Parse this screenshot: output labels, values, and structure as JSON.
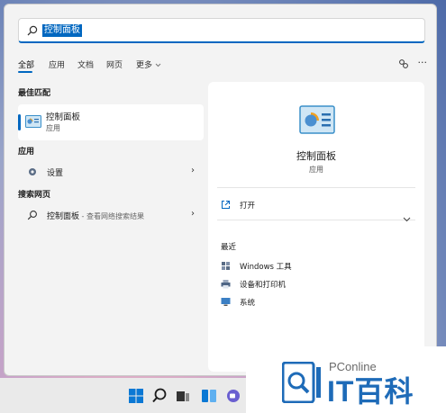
{
  "search": {
    "value": "控制面板"
  },
  "tabs": [
    {
      "label": "全部",
      "active": true
    },
    {
      "label": "应用"
    },
    {
      "label": "文档"
    },
    {
      "label": "网页"
    },
    {
      "label": "更多"
    }
  ],
  "toolbar": {
    "more_label": "···"
  },
  "sections": {
    "best_match": "最佳匹配",
    "apps": "应用",
    "web": "搜索网页"
  },
  "best_match": {
    "name": "控制面板",
    "type": "应用"
  },
  "apps": [
    {
      "label": "设置"
    }
  ],
  "web": [
    {
      "label": "控制面板",
      "suffix": " - 查看网络搜索结果"
    }
  ],
  "detail": {
    "title": "控制面板",
    "subtitle": "应用",
    "open_label": "打开",
    "recent_label": "最近",
    "recent": [
      {
        "label": "Windows 工具",
        "icon": "tools-icon"
      },
      {
        "label": "设备和打印机",
        "icon": "printer-icon"
      },
      {
        "label": "系统",
        "icon": "system-icon"
      }
    ]
  },
  "watermark": {
    "small": "PConline",
    "big": "IT百科"
  },
  "colors": {
    "accent": "#0067c0",
    "watermark_blue": "#1e6bb8"
  }
}
